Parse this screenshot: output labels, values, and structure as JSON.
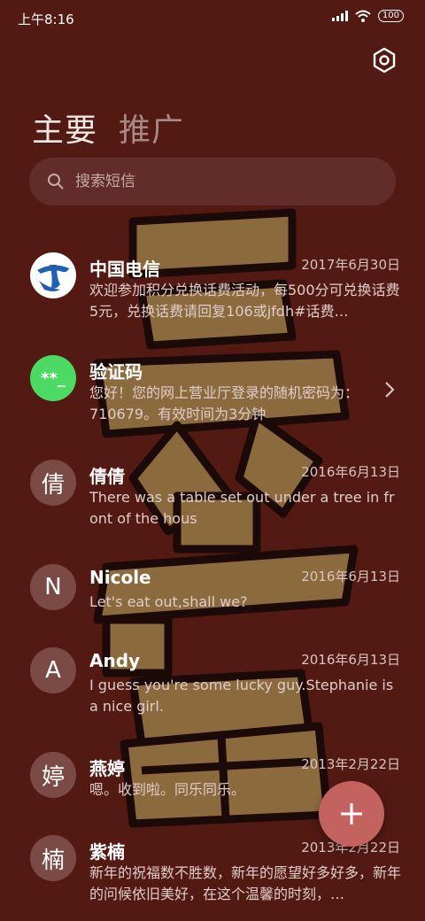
{
  "status_bar": {
    "time": "上午8:16",
    "battery": "100"
  },
  "tabs": [
    {
      "label": "主要"
    },
    {
      "label": "推广"
    }
  ],
  "search": {
    "placeholder": "搜索短信"
  },
  "conversations": [
    {
      "name": "中国电信",
      "date": "2017年6月30日",
      "preview": "欢迎参加积分兑换话费活动，每500分可兑换话费5元，兑换话费请回复106或jfdh#话费…",
      "avatar_type": "telecom-logo"
    },
    {
      "name": "验证码",
      "date": "",
      "preview": "您好！您的网上营业厅登录的随机密码为：710679。有效时间为3分钟",
      "avatar_text": "**_",
      "avatar_color": "#4cd964"
    },
    {
      "name": "倩倩",
      "date": "2016年6月13日",
      "preview": "There was a table set out under a tree in front of the hous",
      "avatar_text": "倩"
    },
    {
      "name": "Nicole",
      "date": "2016年6月13日",
      "preview": "Let's eat out,shall we?",
      "avatar_text": "N"
    },
    {
      "name": "Andy",
      "date": "2016年6月13日",
      "preview": "I guess you're some lucky guy.Stephanie is a nice girl.",
      "avatar_text": "A"
    },
    {
      "name": "燕婷",
      "date": "2013年2月22日",
      "preview": "嗯。收到啦。同乐同乐。",
      "avatar_text": "婷"
    },
    {
      "name": "紫楠",
      "date": "2013年2月22日",
      "preview": "新年的祝福数不胜数，新年的愿望好多好多，新年的问候依旧美好，在这个温馨的时刻，…",
      "avatar_text": "楠"
    }
  ],
  "colors": {
    "background": "#531913",
    "avatar": "#7b4a45",
    "fab": "#c3625f",
    "code_avatar": "#4cd964",
    "telecom_blue": "#1f5fb4"
  },
  "icons": {
    "settings": "gear-hexagon-icon",
    "search": "search-icon",
    "compose": "plus-icon",
    "expand": "chevron-right-icon"
  }
}
